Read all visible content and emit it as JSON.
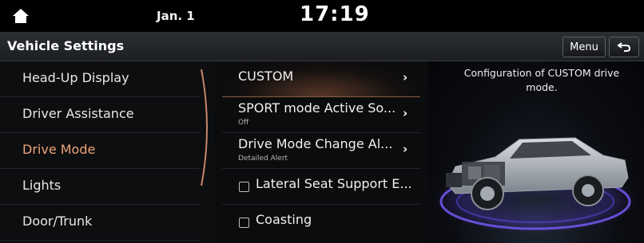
{
  "status": {
    "date": "Jan. 1",
    "time": "17:19"
  },
  "header": {
    "title": "Vehicle Settings",
    "menu_label": "Menu"
  },
  "sidebar": {
    "items": [
      {
        "label": "Head-Up Display"
      },
      {
        "label": "Driver Assistance"
      },
      {
        "label": "Drive Mode",
        "active": true
      },
      {
        "label": "Lights"
      },
      {
        "label": "Door/Trunk"
      }
    ]
  },
  "list": {
    "items": [
      {
        "label": "CUSTOM",
        "type": "submenu"
      },
      {
        "label": "SPORT mode Active So...",
        "sub": "Off",
        "type": "submenu"
      },
      {
        "label": "Drive Mode Change Al...",
        "sub": "Detailed Alert",
        "type": "submenu"
      },
      {
        "label": "Lateral Seat Support E...",
        "type": "checkbox",
        "checked": false
      },
      {
        "label": "Coasting",
        "type": "checkbox",
        "checked": false
      }
    ]
  },
  "info": {
    "description": "Configuration of CUSTOM drive mode."
  },
  "icons": {
    "home": "home-icon",
    "back": "back-arrow-icon",
    "chevron": "chevron-right-icon"
  },
  "colors": {
    "active": "#f0a377",
    "accent_glow": "#7b5cff"
  }
}
